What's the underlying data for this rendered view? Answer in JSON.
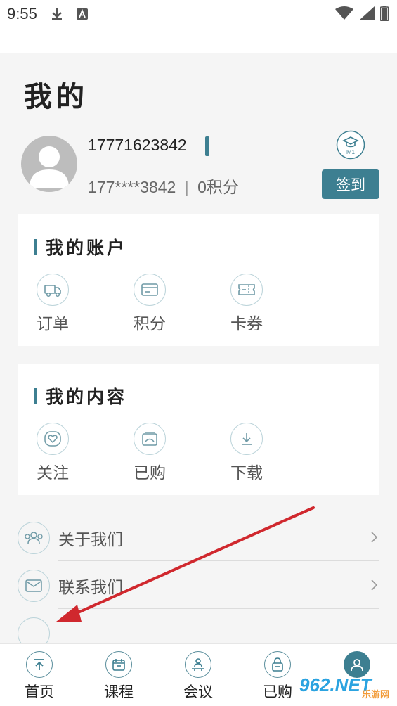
{
  "status_bar": {
    "time": "9:55"
  },
  "page": {
    "title": "我的"
  },
  "user": {
    "phone": "17771623842",
    "masked_phone": "177****3842",
    "separator": "|",
    "points": "0积分",
    "level": "lv.1",
    "checkin_label": "签到"
  },
  "account": {
    "title": "我的账户",
    "items": [
      {
        "label": "订单",
        "icon": "truck-icon"
      },
      {
        "label": "积分",
        "icon": "card-icon"
      },
      {
        "label": "卡券",
        "icon": "ticket-icon"
      }
    ]
  },
  "content": {
    "title": "我的内容",
    "items": [
      {
        "label": "关注",
        "icon": "heart-icon"
      },
      {
        "label": "已购",
        "icon": "purchased-icon"
      },
      {
        "label": "下载",
        "icon": "download-icon"
      }
    ]
  },
  "list": [
    {
      "label": "关于我们",
      "icon": "people-icon"
    },
    {
      "label": "联系我们",
      "icon": "mail-icon"
    }
  ],
  "tabs": [
    {
      "label": "首页",
      "icon": "home-icon"
    },
    {
      "label": "课程",
      "icon": "calendar-icon"
    },
    {
      "label": "会议",
      "icon": "meeting-icon"
    },
    {
      "label": "已购",
      "icon": "lock-icon"
    },
    {
      "label": "我的",
      "icon": "user-icon",
      "active": true
    }
  ],
  "watermark": {
    "brand": "962.NET",
    "sub": "乐游网"
  },
  "colors": {
    "accent": "#3d7f91",
    "annotation_arrow": "#d0282e"
  }
}
